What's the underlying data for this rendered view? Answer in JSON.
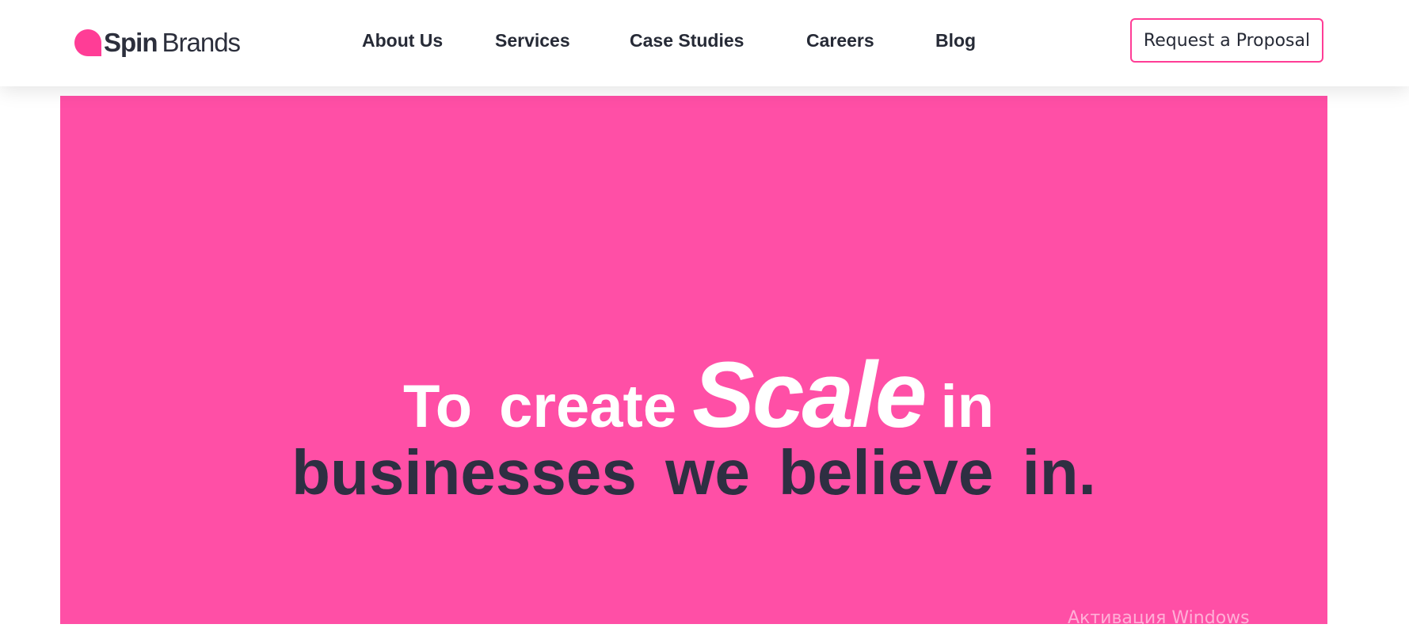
{
  "brand": {
    "name_bold": "Spin",
    "name_light": "Brands",
    "logo_icon": "speech-bubble-logo-icon",
    "accent_color": "#ff3d96"
  },
  "nav": {
    "items": [
      {
        "label": "About Us"
      },
      {
        "label": "Services"
      },
      {
        "label": "Case Studies"
      },
      {
        "label": "Careers"
      },
      {
        "label": "Blog"
      }
    ],
    "cta_label": "Request a Proposal"
  },
  "hero": {
    "background_color": "#ff4fa6",
    "line1": {
      "word_to": "To",
      "word_create": "create",
      "word_scale": "Scale",
      "word_in": "in"
    },
    "line2": "businesses  we  believe in.",
    "line2_color": "#2e2f42"
  },
  "overlay": {
    "watermark_text": "Активация Windows"
  }
}
